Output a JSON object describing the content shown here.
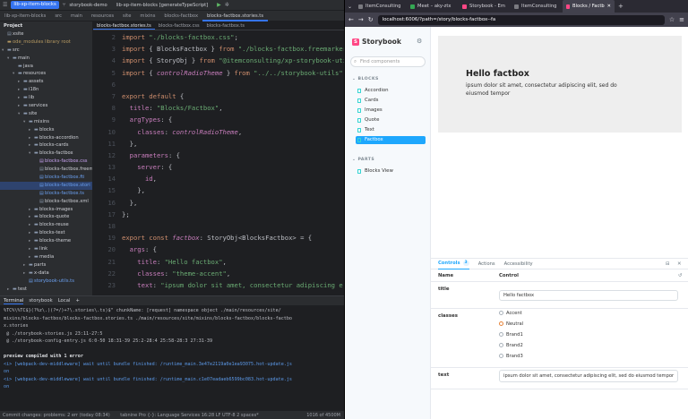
{
  "ide": {
    "project_pill": "lib-xp-item-blocks",
    "branch": "storybook-demo",
    "run_config": "lib-xp-item-blocks [generateTypeScript]",
    "breadcrumbs": [
      "lib-xp-item-blocks",
      "src",
      "main",
      "resources",
      "site",
      "mixins",
      "blocks-factbox",
      "blocks-factbox.stories.ts"
    ],
    "project_label": "Project",
    "tree": [
      {
        "label": "xsite",
        "depth": 0,
        "kind": "plain",
        "arrow": ""
      },
      {
        "label": "ode_modules library root",
        "depth": 0,
        "kind": "mod",
        "arrow": ""
      },
      {
        "label": "src",
        "depth": 0,
        "kind": "folder",
        "arrow": "▾"
      },
      {
        "label": "main",
        "depth": 1,
        "kind": "folder",
        "arrow": "▾"
      },
      {
        "label": "java",
        "depth": 2,
        "kind": "folder",
        "arrow": ""
      },
      {
        "label": "resources",
        "depth": 2,
        "kind": "folder",
        "arrow": "▾"
      },
      {
        "label": "assets",
        "depth": 3,
        "kind": "folder",
        "arrow": "▸"
      },
      {
        "label": "i18n",
        "depth": 3,
        "kind": "folder",
        "arrow": "▸"
      },
      {
        "label": "lib",
        "depth": 3,
        "kind": "folder",
        "arrow": "▸"
      },
      {
        "label": "services",
        "depth": 3,
        "kind": "folder",
        "arrow": "▸"
      },
      {
        "label": "site",
        "depth": 3,
        "kind": "folder",
        "arrow": "▾"
      },
      {
        "label": "mixins",
        "depth": 4,
        "kind": "folder",
        "arrow": "▾"
      },
      {
        "label": "blocks",
        "depth": 5,
        "kind": "folder",
        "arrow": "▸"
      },
      {
        "label": "blocks-accordion",
        "depth": 5,
        "kind": "folder",
        "arrow": "▸"
      },
      {
        "label": "blocks-cards",
        "depth": 5,
        "kind": "folder",
        "arrow": "▸"
      },
      {
        "label": "blocks-factbox",
        "depth": 5,
        "kind": "folder",
        "arrow": "▾"
      },
      {
        "label": "blocks-factbox.css",
        "depth": 6,
        "kind": "css",
        "arrow": ""
      },
      {
        "label": "blocks-factbox.freem",
        "depth": 6,
        "kind": "plain",
        "arrow": ""
      },
      {
        "label": "blocks-factbox.fti",
        "depth": 6,
        "kind": "ts",
        "arrow": ""
      },
      {
        "label": "blocks-factbox.stori",
        "depth": 6,
        "kind": "ts",
        "arrow": "",
        "selected": true
      },
      {
        "label": "blocks-factbox.ts",
        "depth": 6,
        "kind": "ts",
        "arrow": ""
      },
      {
        "label": "blocks-factbox.xml",
        "depth": 6,
        "kind": "plain",
        "arrow": ""
      },
      {
        "label": "blocks-images",
        "depth": 5,
        "kind": "folder",
        "arrow": "▸"
      },
      {
        "label": "blocks-quote",
        "depth": 5,
        "kind": "folder",
        "arrow": "▸"
      },
      {
        "label": "blocks-reuse",
        "depth": 5,
        "kind": "folder",
        "arrow": "▸"
      },
      {
        "label": "blocks-text",
        "depth": 5,
        "kind": "folder",
        "arrow": "▸"
      },
      {
        "label": "blocks-theme",
        "depth": 5,
        "kind": "folder",
        "arrow": "▸"
      },
      {
        "label": "link",
        "depth": 5,
        "kind": "folder",
        "arrow": "▸"
      },
      {
        "label": "media",
        "depth": 5,
        "kind": "folder",
        "arrow": "▸"
      },
      {
        "label": "parts",
        "depth": 4,
        "kind": "folder",
        "arrow": "▸"
      },
      {
        "label": "x-data",
        "depth": 4,
        "kind": "folder",
        "arrow": "▸"
      },
      {
        "label": "storybook-utils.ts",
        "depth": 4,
        "kind": "ts",
        "arrow": ""
      },
      {
        "label": "test",
        "depth": 1,
        "kind": "folder",
        "arrow": "▸"
      }
    ],
    "editor_tabs": [
      {
        "label": "blocks-factbox.stories.ts",
        "active": true
      },
      {
        "label": "blocks-factbox.css",
        "active": false
      },
      {
        "label": "blocks-factbox.ts",
        "active": false
      }
    ],
    "line_numbers": [
      "2",
      "3",
      "4",
      "5",
      "6",
      "7",
      "8",
      "9",
      "10",
      "11",
      "12",
      "13",
      "14",
      "15",
      "16",
      "17",
      "18",
      "19",
      "20",
      "21",
      "22",
      "23"
    ],
    "code_lines": [
      [
        {
          "c": "k",
          "t": "import "
        },
        {
          "c": "s",
          "t": "\"./blocks-factbox.css\""
        },
        {
          "c": "t",
          "t": ";"
        }
      ],
      [
        {
          "c": "k",
          "t": "import "
        },
        {
          "c": "t",
          "t": "{ BlocksFactbox } "
        },
        {
          "c": "k",
          "t": "from "
        },
        {
          "c": "s",
          "t": "\"./blocks-factbox.freemarker\""
        }
      ],
      [
        {
          "c": "k",
          "t": "import "
        },
        {
          "c": "t",
          "t": "{ StoryObj } "
        },
        {
          "c": "k",
          "t": "from "
        },
        {
          "c": "s",
          "t": "\"@itemconsulting/xp-storybook-utils\""
        }
      ],
      [
        {
          "c": "k",
          "t": "import "
        },
        {
          "c": "t",
          "t": "{ "
        },
        {
          "c": "i",
          "t": "controlRadioTheme"
        },
        {
          "c": "t",
          "t": " } "
        },
        {
          "c": "k",
          "t": "from "
        },
        {
          "c": "s",
          "t": "\"../../storybook-utils\""
        }
      ],
      [
        {
          "c": "t",
          "t": ""
        }
      ],
      [
        {
          "c": "k",
          "t": "export default "
        },
        {
          "c": "t",
          "t": "{"
        }
      ],
      [
        {
          "c": "p",
          "t": "  title"
        },
        {
          "c": "t",
          "t": ": "
        },
        {
          "c": "s",
          "t": "\"Blocks/Factbox\""
        },
        {
          "c": "t",
          "t": ","
        }
      ],
      [
        {
          "c": "p",
          "t": "  argTypes"
        },
        {
          "c": "t",
          "t": ": {"
        }
      ],
      [
        {
          "c": "p",
          "t": "    classes"
        },
        {
          "c": "t",
          "t": ": "
        },
        {
          "c": "i",
          "t": "controlRadioTheme"
        },
        {
          "c": "t",
          "t": ","
        }
      ],
      [
        {
          "c": "t",
          "t": "  },"
        }
      ],
      [
        {
          "c": "p",
          "t": "  parameters"
        },
        {
          "c": "t",
          "t": ": {"
        }
      ],
      [
        {
          "c": "p",
          "t": "    server"
        },
        {
          "c": "t",
          "t": ": {"
        }
      ],
      [
        {
          "c": "p",
          "t": "      id"
        },
        {
          "c": "t",
          "t": ","
        }
      ],
      [
        {
          "c": "t",
          "t": "    },"
        }
      ],
      [
        {
          "c": "t",
          "t": "  },"
        }
      ],
      [
        {
          "c": "t",
          "t": "};"
        }
      ],
      [
        {
          "c": "t",
          "t": ""
        }
      ],
      [
        {
          "c": "k",
          "t": "export const "
        },
        {
          "c": "i",
          "t": "factbox"
        },
        {
          "c": "t",
          "t": ": StoryObj<BlocksFactbox> = {"
        }
      ],
      [
        {
          "c": "p",
          "t": "  args"
        },
        {
          "c": "t",
          "t": ": {"
        }
      ],
      [
        {
          "c": "p",
          "t": "    title"
        },
        {
          "c": "t",
          "t": ": "
        },
        {
          "c": "s",
          "t": "\"Hello factbox\""
        },
        {
          "c": "t",
          "t": ","
        }
      ],
      [
        {
          "c": "p",
          "t": "    classes"
        },
        {
          "c": "t",
          "t": ": "
        },
        {
          "c": "s",
          "t": "\"theme-accent\""
        },
        {
          "c": "t",
          "t": ","
        }
      ],
      [
        {
          "c": "p",
          "t": "    text"
        },
        {
          "c": "t",
          "t": ": "
        },
        {
          "c": "s",
          "t": "\"ipsum dolor sit amet, consectetur adipiscing e"
        }
      ]
    ],
    "terminal_tabs": [
      "Terminal",
      "storybook",
      "Local"
    ],
    "terminal_lines": [
      {
        "t": "%TC%\\%TC$}(?%z\\.)(?=/)+?\\.stories\\.ts)$\" chunkName: [request] namespace object ./main/resources/site/",
        "style": ""
      },
      {
        "t": "mixins/blocks-factbox/blocks-factbox.stories.ts ./main/resources/site/mixins/blocks-factbox/blocks-factbo",
        "style": ""
      },
      {
        "t": "x.stories",
        "style": ""
      },
      {
        "t": " @ ./storybook-stories.js 23:11-27:5",
        "style": ""
      },
      {
        "t": " @ ./storybook-config-entry.js 6:0-50 18:31-39 25:2-28:4 25:58-28:3 27:31-39",
        "style": ""
      },
      {
        "t": "",
        "style": ""
      },
      {
        "t": "preview compiled with 1 error",
        "style": "bold"
      },
      {
        "t": "<i> [webpack-dev-middleware] wait until bundle finished: /runtime_main.3e47e2119a0e1ea93075.hot-update.js",
        "style": "blue"
      },
      {
        "t": "on",
        "style": "blue"
      },
      {
        "t": "<i> [webpack-dev-middleware] wait until bundle finished: /runtime_main.c1e07eadaeb6599bc083.hot-update.js",
        "style": "blue"
      },
      {
        "t": "on",
        "style": "blue"
      }
    ],
    "status_left": "Commit changes: problems: 2 err (today 08:34)",
    "status_mid": "tabnine Pro   {-}: Language Services   16:28   LF   UTF-8   2 spaces*",
    "status_right": "1016 of 4500M"
  },
  "browser": {
    "tabs": [
      {
        "label": "ItemConsulting",
        "active": false
      },
      {
        "label": "Meet – aky-ztx",
        "active": false
      },
      {
        "label": "Storybook - Em",
        "active": false
      },
      {
        "label": "ItemConsulting",
        "active": false
      },
      {
        "label": "Blocks / Factb",
        "active": true
      }
    ],
    "url": "localhost:6006/?path=/story/blocks-factbox--fa",
    "storybook": {
      "logo": "Storybook",
      "search_placeholder": "Find components",
      "group_blocks": "BLOCKS",
      "blocks_items": [
        "Accordion",
        "Cards",
        "Images",
        "Quote",
        "Text",
        "Factbox"
      ],
      "selected_item": "Factbox",
      "group_parts": "PARTS",
      "parts_items": [
        "Blocks View"
      ]
    },
    "preview": {
      "title": "Hello factbox",
      "text": "ipsum dolor sit amet, consectetur adipiscing elit, sed do eiusmod tempor"
    },
    "addons": {
      "tabs": [
        "Controls",
        "Actions",
        "Accessibility"
      ],
      "controls_count": "3",
      "col_name": "Name",
      "col_control": "Control",
      "rows": {
        "title": {
          "name": "title",
          "value": "Hello factbox"
        },
        "classes": {
          "name": "classes",
          "options": [
            "Accent",
            "Neutral",
            "Brand1",
            "Brand2",
            "Brand3"
          ],
          "selected": "Neutral"
        },
        "text": {
          "name": "text",
          "value": "ipsum dolor sit amet, consectetur adipiscing elit, sed do eiusmod tempor"
        }
      }
    },
    "colors": {
      "storybook_accent": "#1ea7fd",
      "storybook_pink": "#ff4785",
      "radio_selected": "#e6843a",
      "ide_accent": "#3574f0"
    }
  }
}
